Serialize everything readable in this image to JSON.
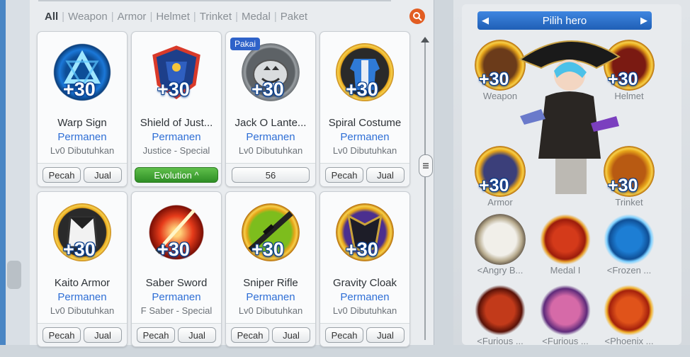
{
  "filters": [
    "All",
    "Weapon",
    "Armor",
    "Helmet",
    "Trinket",
    "Medal",
    "Paket"
  ],
  "items": [
    {
      "name": "Warp Sign",
      "duration": "Permanen",
      "requirement": "Lv0 Dibutuhkan",
      "plus": "+30",
      "actions": [
        "Pecah",
        "Jual"
      ]
    },
    {
      "name": "Shield of Just...",
      "duration": "Permanen",
      "requirement": "Justice - Special",
      "plus": "+30",
      "evolution": "Evolution ^"
    },
    {
      "name": "Jack O Lante...",
      "duration": "Permanen",
      "requirement": "Lv0 Dibutuhkan",
      "plus": "+30",
      "badge": "Pakai",
      "count": "56"
    },
    {
      "name": "Spiral Costume",
      "duration": "Permanen",
      "requirement": "Lv0 Dibutuhkan",
      "plus": "+30",
      "actions": [
        "Pecah",
        "Jual"
      ]
    },
    {
      "name": "Kaito Armor",
      "duration": "Permanen",
      "requirement": "Lv0 Dibutuhkan",
      "plus": "+30",
      "actions": [
        "Pecah",
        "Jual"
      ]
    },
    {
      "name": "Saber Sword",
      "duration": "Permanen",
      "requirement": "F Saber - Special",
      "plus": "+30",
      "actions": [
        "Pecah",
        "Jual"
      ]
    },
    {
      "name": "Sniper Rifle",
      "duration": "Permanen",
      "requirement": "Lv0 Dibutuhkan",
      "plus": "+30",
      "actions": [
        "Pecah",
        "Jual"
      ]
    },
    {
      "name": "Gravity Cloak",
      "duration": "Permanen",
      "requirement": "Lv0 Dibutuhkan",
      "plus": "+30",
      "actions": [
        "Pecah",
        "Jual"
      ]
    }
  ],
  "hero": {
    "title": "Pilih hero",
    "slots": {
      "weapon": {
        "label": "Weapon",
        "plus": "+30"
      },
      "helmet": {
        "label": "Helmet",
        "plus": "+30"
      },
      "armor": {
        "label": "Armor",
        "plus": "+30"
      },
      "trinket": {
        "label": "Trinket",
        "plus": "+30"
      },
      "angry": {
        "label": "<Angry B..."
      },
      "medal": {
        "label": "Medal I"
      },
      "frozen": {
        "label": "<Frozen ..."
      },
      "furious1": {
        "label": "<Furious ..."
      },
      "furious2": {
        "label": "<Furious ..."
      },
      "phoenix": {
        "label": "<Phoenix ..."
      }
    }
  },
  "colors": {
    "accent": "#2f6fd6",
    "evolution": "#3aa12f",
    "badge": "#2e62c9",
    "search": "#e25d22",
    "hero_bar": "#2a6fcc"
  }
}
